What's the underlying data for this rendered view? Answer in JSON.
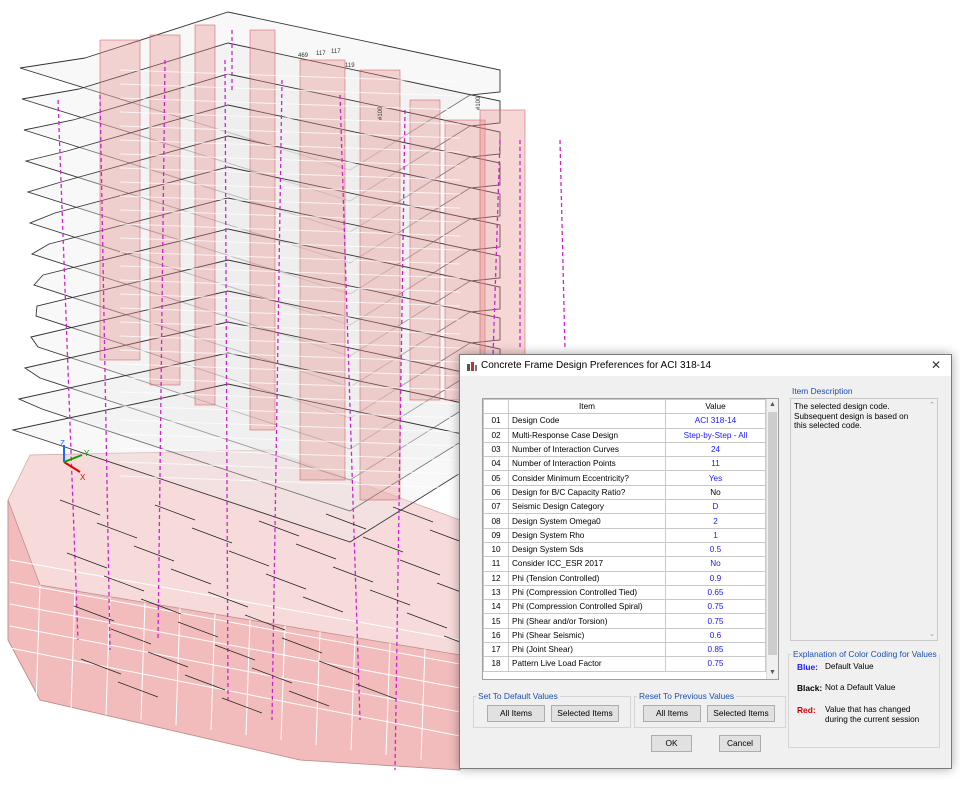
{
  "dialog": {
    "title": "Concrete Frame Design Preferences for ACI 318-14",
    "close_glyph": "✕",
    "table": {
      "header_item": "Item",
      "header_value": "Value",
      "rows": [
        {
          "num": "01",
          "item": "Design Code",
          "value": "ACI 318-14",
          "color": "blue"
        },
        {
          "num": "02",
          "item": "Multi-Response Case Design",
          "value": "Step-by-Step - All",
          "color": "blue"
        },
        {
          "num": "03",
          "item": "Number of Interaction Curves",
          "value": "24",
          "color": "blue"
        },
        {
          "num": "04",
          "item": "Number of Interaction Points",
          "value": "11",
          "color": "blue"
        },
        {
          "num": "05",
          "item": "Consider Minimum Eccentricity?",
          "value": "Yes",
          "color": "blue"
        },
        {
          "num": "06",
          "item": "Design for B/C Capacity Ratio?",
          "value": "No",
          "color": "black"
        },
        {
          "num": "07",
          "item": "Seismic Design Category",
          "value": "D",
          "color": "blue"
        },
        {
          "num": "08",
          "item": "Design System Omega0",
          "value": "2",
          "color": "blue"
        },
        {
          "num": "09",
          "item": "Design System Rho",
          "value": "1",
          "color": "blue"
        },
        {
          "num": "10",
          "item": "Design System Sds",
          "value": "0.5",
          "color": "blue"
        },
        {
          "num": "11",
          "item": "Consider ICC_ESR 2017",
          "value": "No",
          "color": "blue"
        },
        {
          "num": "12",
          "item": "Phi (Tension Controlled)",
          "value": "0.9",
          "color": "blue"
        },
        {
          "num": "13",
          "item": "Phi (Compression Controlled Tied)",
          "value": "0.65",
          "color": "blue"
        },
        {
          "num": "14",
          "item": "Phi (Compression Controlled Spiral)",
          "value": "0.75",
          "color": "blue"
        },
        {
          "num": "15",
          "item": "Phi (Shear and/or Torsion)",
          "value": "0.75",
          "color": "blue"
        },
        {
          "num": "16",
          "item": "Phi (Shear Seismic)",
          "value": "0.6",
          "color": "blue"
        },
        {
          "num": "17",
          "item": "Phi (Joint Shear)",
          "value": "0.85",
          "color": "blue"
        },
        {
          "num": "18",
          "item": "Pattern Live Load Factor",
          "value": "0.75",
          "color": "blue"
        }
      ]
    },
    "set_default": {
      "title": "Set To Default Values",
      "all_items": "All Items",
      "selected_items": "Selected Items"
    },
    "reset_previous": {
      "title": "Reset To Previous Values",
      "all_items": "All Items",
      "selected_items": "Selected Items"
    },
    "ok_label": "OK",
    "cancel_label": "Cancel",
    "item_description": {
      "title": "Item Description",
      "text": "The selected design code. Subsequent design is based on this selected code."
    },
    "color_coding": {
      "title": "Explanation of Color Coding for Values",
      "blue_label": "Blue:",
      "blue_text": "Default Value",
      "black_label": "Black:",
      "black_text": "Not a Default Value",
      "red_label": "Red:",
      "red_text": "Value that has changed during the current session"
    }
  },
  "model_view": {
    "axis_labels": [
      "Z",
      "X",
      "Y"
    ],
    "tags": [
      "469",
      "117",
      "117",
      "119",
      "#100",
      "#100"
    ]
  },
  "colors": {
    "default_blue": "#1a1aff",
    "legend_blue": "#1a4fb4",
    "red": "#d40000",
    "section_pink": "#e88a8a",
    "frame_magenta": "#d021d0"
  }
}
